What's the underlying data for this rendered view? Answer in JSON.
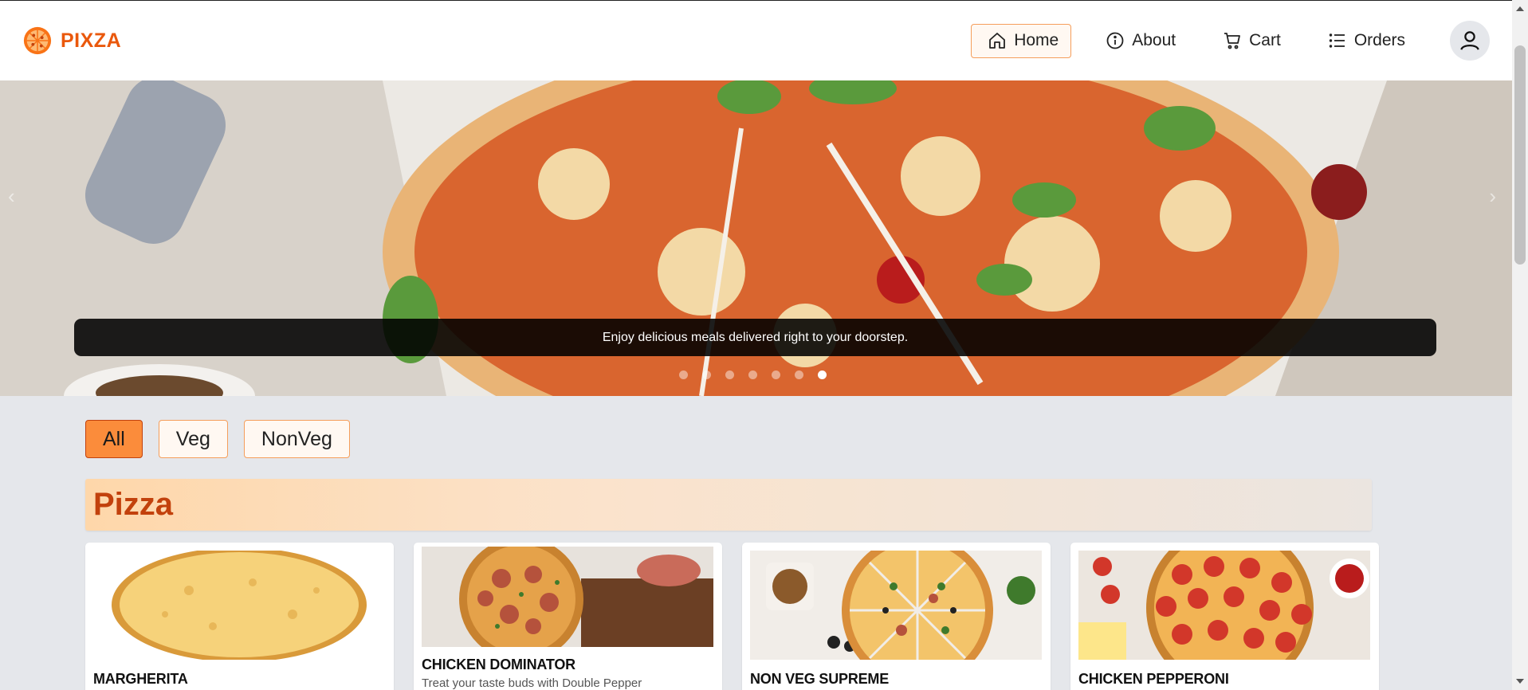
{
  "brand": {
    "name": "PIXZA",
    "icon": "pizza-icon",
    "color": "#ea580c"
  },
  "nav": {
    "items": [
      {
        "label": "Home",
        "icon": "home-icon",
        "active": true
      },
      {
        "label": "About",
        "icon": "info-icon",
        "active": false
      },
      {
        "label": "Cart",
        "icon": "cart-icon",
        "active": false
      },
      {
        "label": "Orders",
        "icon": "list-icon",
        "active": false
      }
    ],
    "profile_icon": "user-icon"
  },
  "hero": {
    "caption": "Enjoy delicious meals delivered right to your doorstep.",
    "slide_count": 7,
    "active_slide": 7
  },
  "filters": {
    "options": [
      "All",
      "Veg",
      "NonVeg"
    ],
    "selected": "All"
  },
  "category": {
    "title": "Pizza"
  },
  "products": [
    {
      "name": "MARGHERITA",
      "description": ""
    },
    {
      "name": "CHICKEN DOMINATOR",
      "description": "Treat your taste buds with Double Pepper"
    },
    {
      "name": "NON VEG SUPREME",
      "description": ""
    },
    {
      "name": "CHICKEN PEPPERONI",
      "description": ""
    }
  ],
  "colors": {
    "accent": "#fb8c3b",
    "accent_dark": "#c2410c",
    "page_bg": "#e5e7eb"
  }
}
